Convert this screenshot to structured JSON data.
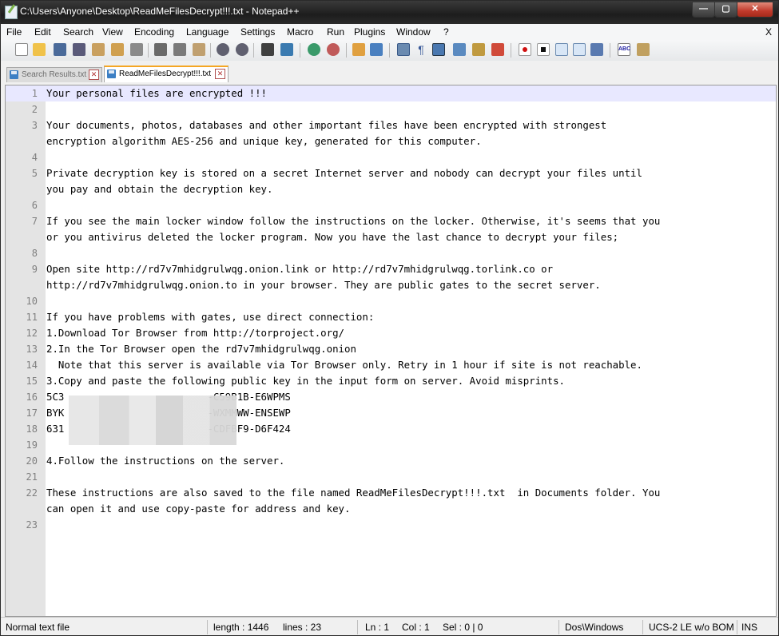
{
  "window": {
    "title": "C:\\Users\\Anyone\\Desktop\\ReadMeFilesDecrypt!!!.txt - Notepad++",
    "minimize": "—",
    "maximize": "▢",
    "close": "✕"
  },
  "menu": {
    "items": [
      "File",
      "Edit",
      "Search",
      "View",
      "Encoding",
      "Language",
      "Settings",
      "Macro",
      "Run",
      "Plugins",
      "Window",
      "?"
    ],
    "close_doc": "X"
  },
  "toolbar": {
    "icons": [
      "new-file-icon",
      "open-file-icon",
      "save-icon",
      "save-all-icon",
      "close-icon",
      "close-all-icon",
      "print-icon",
      "cut-icon",
      "copy-icon",
      "paste-icon",
      "undo-icon",
      "redo-icon",
      "find-icon",
      "replace-icon",
      "zoom-in-icon",
      "zoom-out-icon",
      "sync-vertical-icon",
      "sync-horizontal-icon",
      "word-wrap-icon",
      "show-all-chars-icon",
      "indent-guide-icon",
      "doc-map-icon",
      "function-list-icon",
      "folder-workspace-icon",
      "record-macro-icon",
      "stop-record-icon",
      "play-macro-icon",
      "run-macro-multiple-icon",
      "save-macro-icon",
      "spell-check-icon",
      "spell-check-options-icon"
    ]
  },
  "tabs": [
    {
      "label": "Search Results.txt",
      "active": false
    },
    {
      "label": "ReadMeFilesDecrypt!!!.txt",
      "active": true
    }
  ],
  "editor": {
    "lines": [
      {
        "n": "1",
        "t": "Your personal files are encrypted !!!"
      },
      {
        "n": "2",
        "t": ""
      },
      {
        "n": "3",
        "t": "Your documents, photos, databases and other important files have been encrypted with strongest"
      },
      {
        "n": "",
        "t": "encryption algorithm AES-256 and unique key, generated for this computer."
      },
      {
        "n": "4",
        "t": ""
      },
      {
        "n": "5",
        "t": "Private decryption key is stored on a secret Internet server and nobody can decrypt your files until"
      },
      {
        "n": "",
        "t": "you pay and obtain the decryption key."
      },
      {
        "n": "6",
        "t": ""
      },
      {
        "n": "7",
        "t": "If you see the main locker window follow the instructions on the locker. Otherwise, it's seems that you"
      },
      {
        "n": "",
        "t": "or you antivirus deleted the locker program. Now you have the last chance to decrypt your files;"
      },
      {
        "n": "8",
        "t": ""
      },
      {
        "n": "9",
        "t": "Open site http://rd7v7mhidgrulwqg.onion.link or http://rd7v7mhidgrulwqg.torlink.co or"
      },
      {
        "n": "",
        "t": "http://rd7v7mhidgrulwqg.onion.to in your browser. They are public gates to the secret server."
      },
      {
        "n": "10",
        "t": ""
      },
      {
        "n": "11",
        "t": "If you have problems with gates, use direct connection:"
      },
      {
        "n": "12",
        "t": "1.Download Tor Browser from http://torproject.org/"
      },
      {
        "n": "13",
        "t": "2.In the Tor Browser open the rd7v7mhidgrulwqg.onion"
      },
      {
        "n": "14",
        "t": "  Note that this server is available via Tor Browser only. Retry in 1 hour if site is not reachable."
      },
      {
        "n": "15",
        "t": "3.Copy and paste the following public key in the input form on server. Avoid misprints."
      },
      {
        "n": "16",
        "t": "5C3                        -C59B1B-E6WPMS"
      },
      {
        "n": "17",
        "t": "BYK                        -WXMMWW-ENSEWP"
      },
      {
        "n": "18",
        "t": "631                        -CDFBF9-D6F424"
      },
      {
        "n": "19",
        "t": ""
      },
      {
        "n": "20",
        "t": "4.Follow the instructions on the server."
      },
      {
        "n": "21",
        "t": ""
      },
      {
        "n": "22",
        "t": "These instructions are also saved to the file named ReadMeFilesDecrypt!!!.txt  in Documents folder. You"
      },
      {
        "n": "",
        "t": "can open it and use copy-paste for address and key."
      },
      {
        "n": "23",
        "t": ""
      }
    ]
  },
  "status": {
    "file_type": "Normal text file",
    "length": "length : 1446",
    "lines": "lines : 23",
    "ln": "Ln : 1",
    "col": "Col : 1",
    "sel": "Sel : 0 | 0",
    "eol": "Dos\\Windows",
    "encoding": "UCS-2 LE w/o BOM",
    "mode": "INS"
  }
}
